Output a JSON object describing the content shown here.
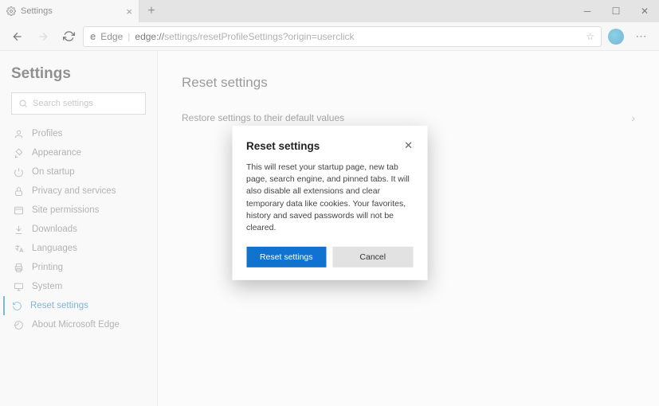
{
  "titlebar": {
    "tab_title": "Settings",
    "new_tab": "+"
  },
  "toolbar": {
    "edge_label": "Edge",
    "url_host": "edge://",
    "url_path": "settings/resetProfileSettings?origin=userclick"
  },
  "sidebar": {
    "heading": "Settings",
    "search_placeholder": "Search settings",
    "items": [
      {
        "label": "Profiles"
      },
      {
        "label": "Appearance"
      },
      {
        "label": "On startup"
      },
      {
        "label": "Privacy and services"
      },
      {
        "label": "Site permissions"
      },
      {
        "label": "Downloads"
      },
      {
        "label": "Languages"
      },
      {
        "label": "Printing"
      },
      {
        "label": "System"
      },
      {
        "label": "Reset settings"
      },
      {
        "label": "About Microsoft Edge"
      }
    ]
  },
  "main": {
    "heading": "Reset settings",
    "row_label": "Restore settings to their default values"
  },
  "modal": {
    "title": "Reset settings",
    "body": "This will reset your startup page, new tab page, search engine, and pinned tabs. It will also disable all extensions and clear temporary data like cookies. Your favorites, history and saved passwords will not be cleared.",
    "primary": "Reset settings",
    "secondary": "Cancel"
  }
}
